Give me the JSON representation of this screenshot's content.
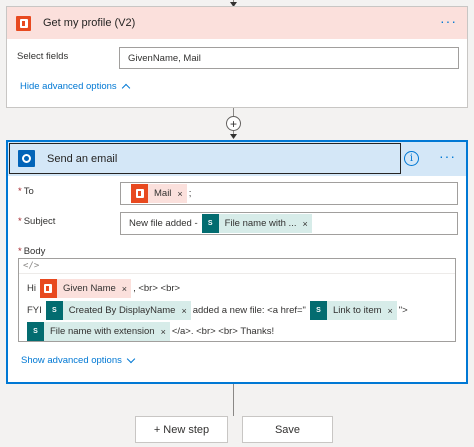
{
  "card1": {
    "title": "Get my profile (V2)",
    "more": "···",
    "select_fields_label": "Select fields",
    "select_fields_value": "GivenName, Mail",
    "hide_advanced": "Hide advanced options"
  },
  "card2": {
    "title": "Send an email",
    "more": "···",
    "info": "i",
    "to_label": "To",
    "to_token": "Mail",
    "to_suffix": ";",
    "subject_label": "Subject",
    "subject_text": "New file added -",
    "subject_token": "File name with ...",
    "body_label": "Body",
    "code_icon": "</>",
    "body_line1": {
      "prefix": "Hi",
      "token": "Given Name",
      "suffix": ", <br> <br>"
    },
    "body_line2": {
      "prefix": "FYI",
      "token1": "Created By DisplayName",
      "middle": "added a new file: <a href=\"",
      "token2": "Link to item",
      "suffix": "\">"
    },
    "body_line3": {
      "token": "File name with extension",
      "suffix": "</a>. <br> <br> Thanks!"
    },
    "show_advanced": "Show advanced options"
  },
  "buttons": {
    "new_step": "+ New step",
    "save": "Save"
  },
  "token_remove": "×",
  "plus": "+"
}
